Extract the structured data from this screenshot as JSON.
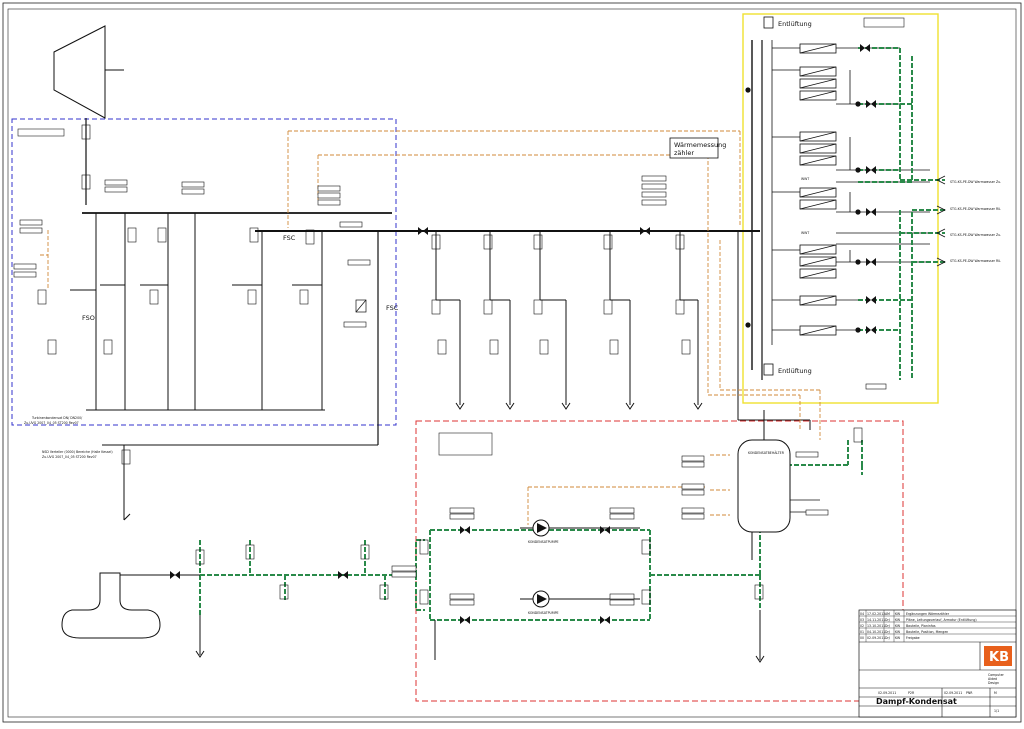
{
  "drawing": {
    "title": "Dampf-Kondensat",
    "labels": {
      "entlueftung_top": "Entlüftung",
      "entlueftung_bottom": "Entlüftung",
      "waermemessung_line1": "Wärmemessung",
      "waermemessung_line2": "zähler",
      "fsc_main": "FSC",
      "fsc_right": "FSC",
      "fso": "FSO",
      "wwt_1": "WWT",
      "wwt_2": "WWT",
      "condensate_tank": "KONDENSATBEHÄLTER",
      "pump_1": "KONDENSATPUMPE",
      "pump_2": "KONDENSATPUMPE"
    },
    "notes": {
      "turbine_note_line1": "Turbinenkondensat DN/ DN200/",
      "turbine_note_line2": "Zu.UVG 2007_04_05 ST200 Rev07",
      "distributor_note_line1": "NSD Verteiler (0000) Bereiche (Halle Kessel)",
      "distributor_note_line2": "Zu.UVG 2007_04_05 ST200 Rev07"
    },
    "outputs": [
      "STG-KS-PE-DW Warmwasser Zu.",
      "STG-KS-PE-DW Warmwasser Rü.",
      "STG-KS-PE-DW Warmwasser Zu.",
      "STG-KS-PE-DW Warmwasser Rü."
    ],
    "revisions": [
      {
        "rev": "04",
        "date": "17.02.2012",
        "by": "AM",
        "check": "KW",
        "text": "Ergänzungen Wärmezähler"
      },
      {
        "rev": "03",
        "date": "14.11.2011",
        "by": "DrJ",
        "check": "KW",
        "text": "Pläne, Leitungsverlauf, Armatur (Entlüftung)"
      },
      {
        "rev": "02",
        "date": "13.10.2011",
        "by": "DrJ",
        "check": "KW",
        "text": "Bauteile, Planinfos"
      },
      {
        "rev": "01",
        "date": "04.10.2011",
        "by": "DrJ",
        "check": "KW",
        "text": "Bauteile, Position, Mengen"
      },
      {
        "rev": "00",
        "date": "02.09.2011",
        "by": "DrJ",
        "check": "KW",
        "text": "Freigabe"
      }
    ],
    "company": {
      "logo": "KB",
      "tagline_1": "Computer",
      "tagline_2": "Aided",
      "tagline_3": "Design"
    },
    "title_block": {
      "date_1": "02.09.2011",
      "drawn": "P2R",
      "date_2": "02.09.2011",
      "checked": "PNR",
      "scale": "M",
      "sheet": "1/1"
    }
  },
  "colors": {
    "line": "#111111",
    "steam_box": "#3333cc",
    "condensate_box": "#dd3333",
    "hx_box": "#f0e030",
    "warm_water": "#2a8a4a",
    "measure_line": "#d08a3a"
  }
}
